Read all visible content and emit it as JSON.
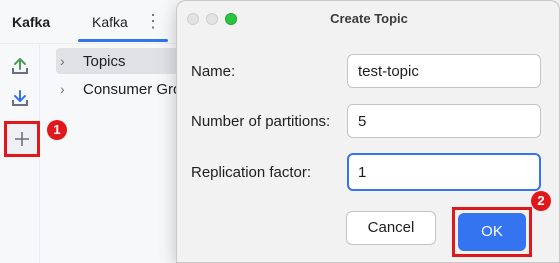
{
  "tool_window": {
    "title": "Kafka",
    "tab_label": "Kafka",
    "more_icon": "⋮"
  },
  "toolbar": {
    "icons": [
      "upload-icon",
      "download-icon",
      "add-icon"
    ],
    "badge_1": "1"
  },
  "tree": {
    "items": [
      {
        "label": "Topics",
        "chevron": "›"
      },
      {
        "label": "Consumer Gro",
        "chevron": "›"
      }
    ]
  },
  "dialog": {
    "title": "Create Topic",
    "fields": [
      {
        "label": "Name:",
        "value": "test-topic"
      },
      {
        "label": "Number of partitions:",
        "value": "5"
      },
      {
        "label": "Replication factor:",
        "value": "1"
      }
    ],
    "cancel_label": "Cancel",
    "ok_label": "OK",
    "badge_2": "2"
  },
  "colors": {
    "accent": "#3574f0",
    "highlight_red": "#e0181c",
    "icon_green": "#4f9b59",
    "icon_blue": "#3574f0"
  }
}
